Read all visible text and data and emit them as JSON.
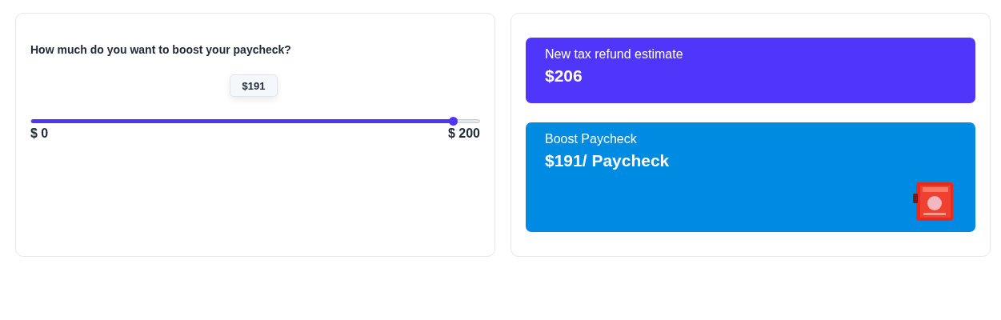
{
  "question": "How much do you want to boost your paycheck?",
  "slider": {
    "level": 0.94,
    "tooltip": "$191",
    "min_label": "$ 0",
    "max_label": "$ 200"
  },
  "refund": {
    "label": "New tax refund estimate",
    "value": "$206"
  },
  "boost": {
    "label": "Boost Paycheck",
    "value": "$191/ Paycheck"
  }
}
